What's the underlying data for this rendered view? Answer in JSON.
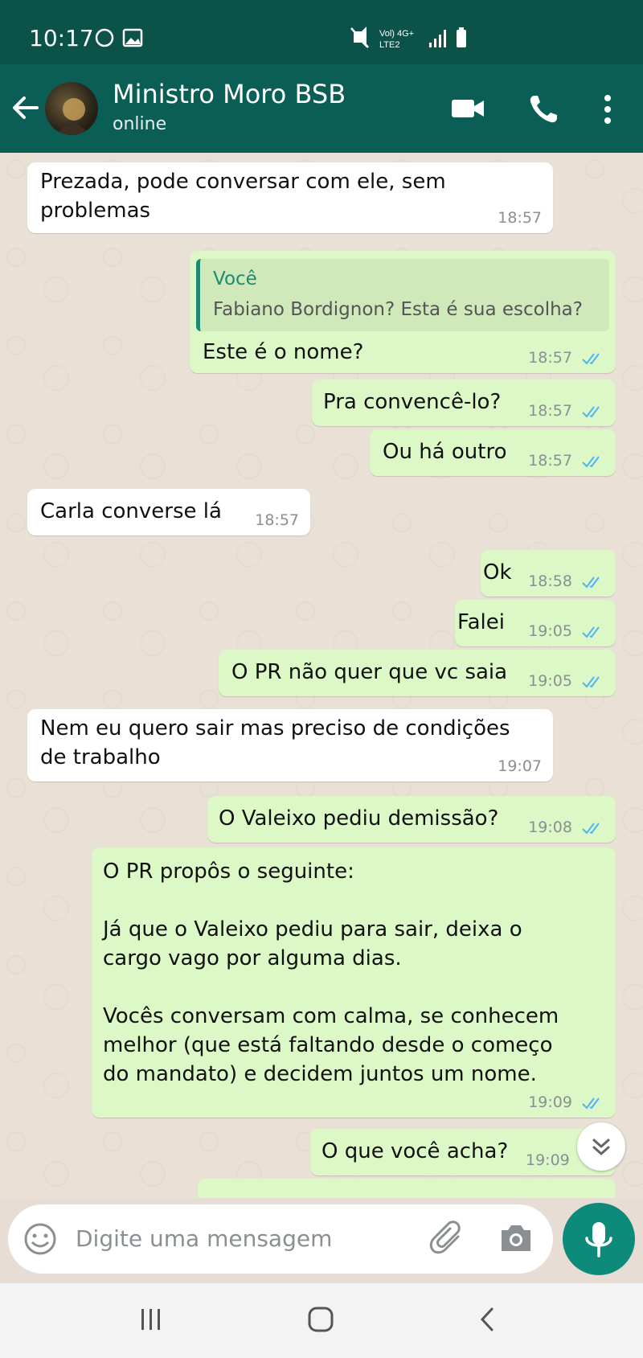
{
  "status": {
    "time": "10:17",
    "net1": "Vol) 4G+",
    "net2": "LTE2"
  },
  "header": {
    "contact": "Ministro Moro BSB",
    "presence": "online"
  },
  "quote": {
    "author": "Você",
    "text": "Fabiano Bordignon? Esta é sua escolha?"
  },
  "messages": {
    "m1": {
      "line1": "Prezada, pode conversar com ele, sem",
      "line2": "problemas",
      "time": "18:57"
    },
    "m2": {
      "text": "Este é o nome?",
      "time": "18:57"
    },
    "m3": {
      "text": "Pra convencê-lo?",
      "time": "18:57"
    },
    "m4": {
      "text": "Ou há outro",
      "time": "18:57"
    },
    "m5": {
      "text": "Carla converse lá",
      "time": "18:57"
    },
    "m6": {
      "text": "Ok",
      "time": "18:58"
    },
    "m7": {
      "text": "Falei",
      "time": "19:05"
    },
    "m8": {
      "text": "O PR não quer que vc saia",
      "time": "19:05"
    },
    "m9": {
      "line1": "Nem eu quero sair mas preciso de condições",
      "line2": "de trabalho",
      "time": "19:07"
    },
    "m10": {
      "text": "O Valeixo pediu demissão?",
      "time": "19:08"
    },
    "m11": {
      "l1": "O PR propôs o seguinte:",
      "l2": "Já que o Valeixo pediu para sair, deixa o",
      "l3": "cargo vago por alguma dias.",
      "l4": "Vocês conversam com calma, se conhecem",
      "l5": "melhor (que está faltando desde o começo",
      "l6": "do mandato) e decidem juntos um nome.",
      "time": "19:09"
    },
    "m12": {
      "text": "O que você acha?",
      "time": "19:09"
    }
  },
  "input": {
    "placeholder": "Digite uma mensagem"
  },
  "colors": {
    "header": "#0b5e55",
    "status": "#0b5249",
    "outgoing": "#dcf8c6",
    "incoming": "#ffffff",
    "ticks": "#4fb3f6",
    "fab": "#0e8a7a"
  },
  "icons": [
    "back-arrow-icon",
    "video-call-icon",
    "phone-icon",
    "more-vert-icon",
    "emoji-icon",
    "attach-icon",
    "camera-icon",
    "mic-icon",
    "double-check-icon",
    "chevron-double-down-icon"
  ]
}
